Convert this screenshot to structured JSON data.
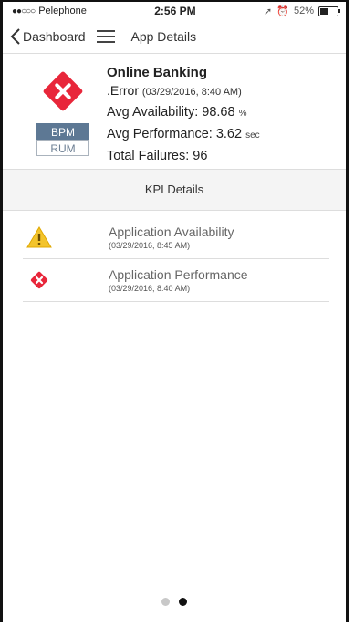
{
  "status_bar": {
    "carrier": "Pelephone",
    "time": "2:56 PM",
    "battery": "52%",
    "battery_level": 0.52
  },
  "nav": {
    "back_label": "Dashboard",
    "title": "App Details"
  },
  "app": {
    "name": "Online Banking",
    "status_prefix": ".",
    "status": "Error",
    "status_time": "(03/29/2016, 8:40 AM)",
    "availability_label": "Avg Availability:",
    "availability_value": "98.68",
    "availability_unit": "%",
    "performance_label": "Avg Performance:",
    "performance_value": "3.62",
    "performance_unit": "sec",
    "failures_label": "Total Failures:",
    "failures_value": "96",
    "tags": [
      "BPM",
      "RUM"
    ]
  },
  "kpi": {
    "header": "KPI Details",
    "items": [
      {
        "name": "Application Availability",
        "time": "(03/29/2016, 8:45 AM)",
        "icon": "warning-icon"
      },
      {
        "name": "Application Performance",
        "time": "(03/29/2016, 8:40 AM)",
        "icon": "error-icon"
      }
    ]
  },
  "colors": {
    "error": "#e8263a",
    "warning": "#f3c42c",
    "bpm_tag": "#5d7894"
  },
  "pager": {
    "pages": 2,
    "active": 2
  }
}
